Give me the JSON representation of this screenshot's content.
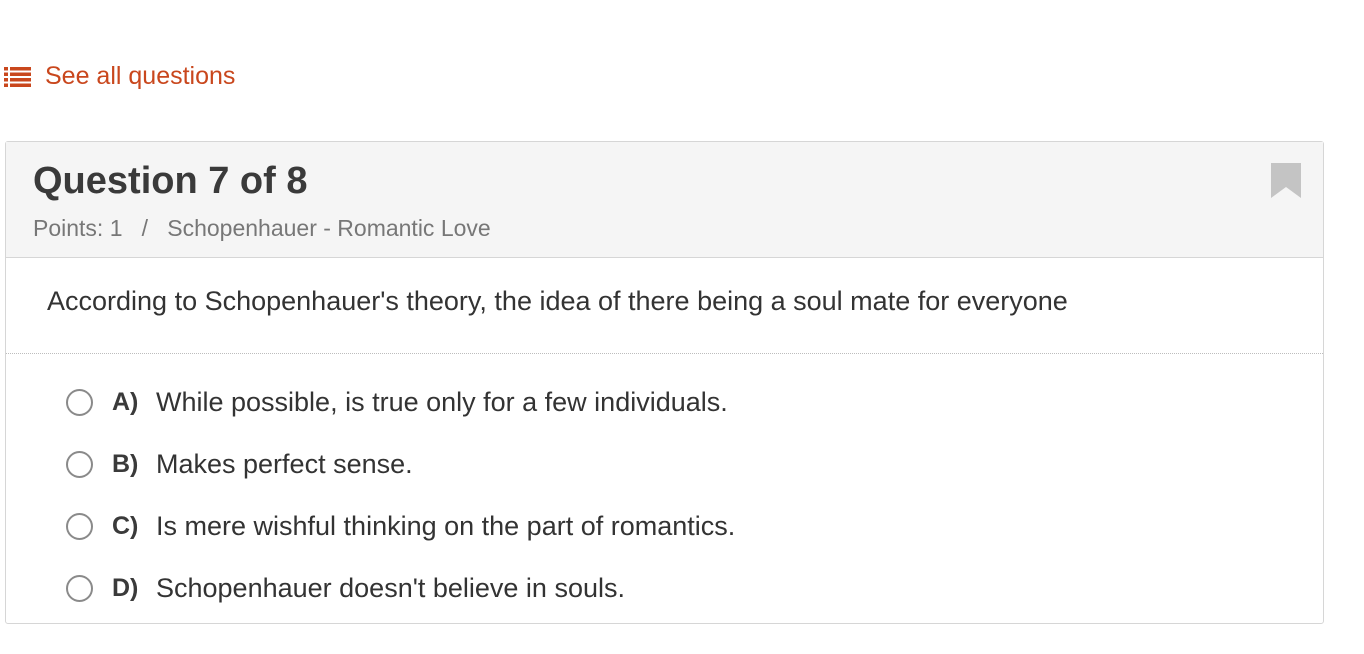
{
  "nav": {
    "see_all_label": "See all questions",
    "icon": "list-icon"
  },
  "question": {
    "title": "Question 7 of 8",
    "meta": "Points: 1   /   Schopenhauer - Romantic Love",
    "bookmark_icon": "bookmark-icon",
    "text": "According to Schopenhauer's theory, the idea of there being a soul mate for everyone"
  },
  "choices": [
    {
      "letter": "A)",
      "text": "While possible, is true only for a few individuals."
    },
    {
      "letter": "B)",
      "text": "Makes perfect sense."
    },
    {
      "letter": "C)",
      "text": "Is mere wishful thinking on the part of romantics."
    },
    {
      "letter": "D)",
      "text": "Schopenhauer doesn't believe in souls."
    }
  ],
  "colors": {
    "accent": "#c9471d",
    "header_bg": "#f5f5f5",
    "border": "#d6d6d6",
    "bookmark": "#c4c4c4"
  }
}
